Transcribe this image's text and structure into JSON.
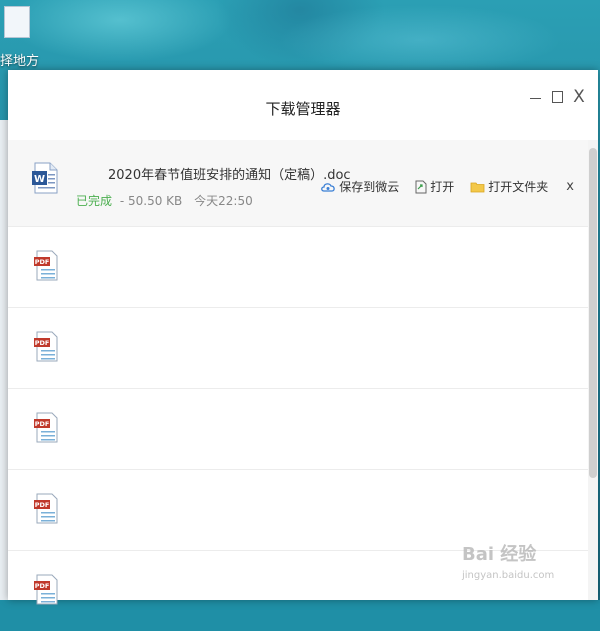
{
  "desktop": {
    "icon_label": "择地方"
  },
  "window": {
    "title": "下载管理器",
    "controls": {
      "minimize": "—",
      "maximize": "☐",
      "close": "X"
    }
  },
  "downloads": [
    {
      "type": "doc",
      "name": "2020年春节值班安排的通知（定稿）.doc",
      "status": "已完成",
      "size": "50.50 KB",
      "time": "今天22:50",
      "actions": [
        "保存到微云",
        "打开",
        "打开文件夹"
      ],
      "close": "x"
    },
    {
      "type": "pdf"
    },
    {
      "type": "pdf"
    },
    {
      "type": "pdf"
    },
    {
      "type": "pdf"
    },
    {
      "type": "pdf"
    }
  ],
  "watermark": {
    "main": "Bai 经验",
    "sub": "jingyan.baidu.com"
  },
  "colors": {
    "status_green": "#4caf50",
    "pdf_red": "#c0392b",
    "doc_blue": "#2b5797",
    "folder_yellow": "#f3c84a"
  }
}
